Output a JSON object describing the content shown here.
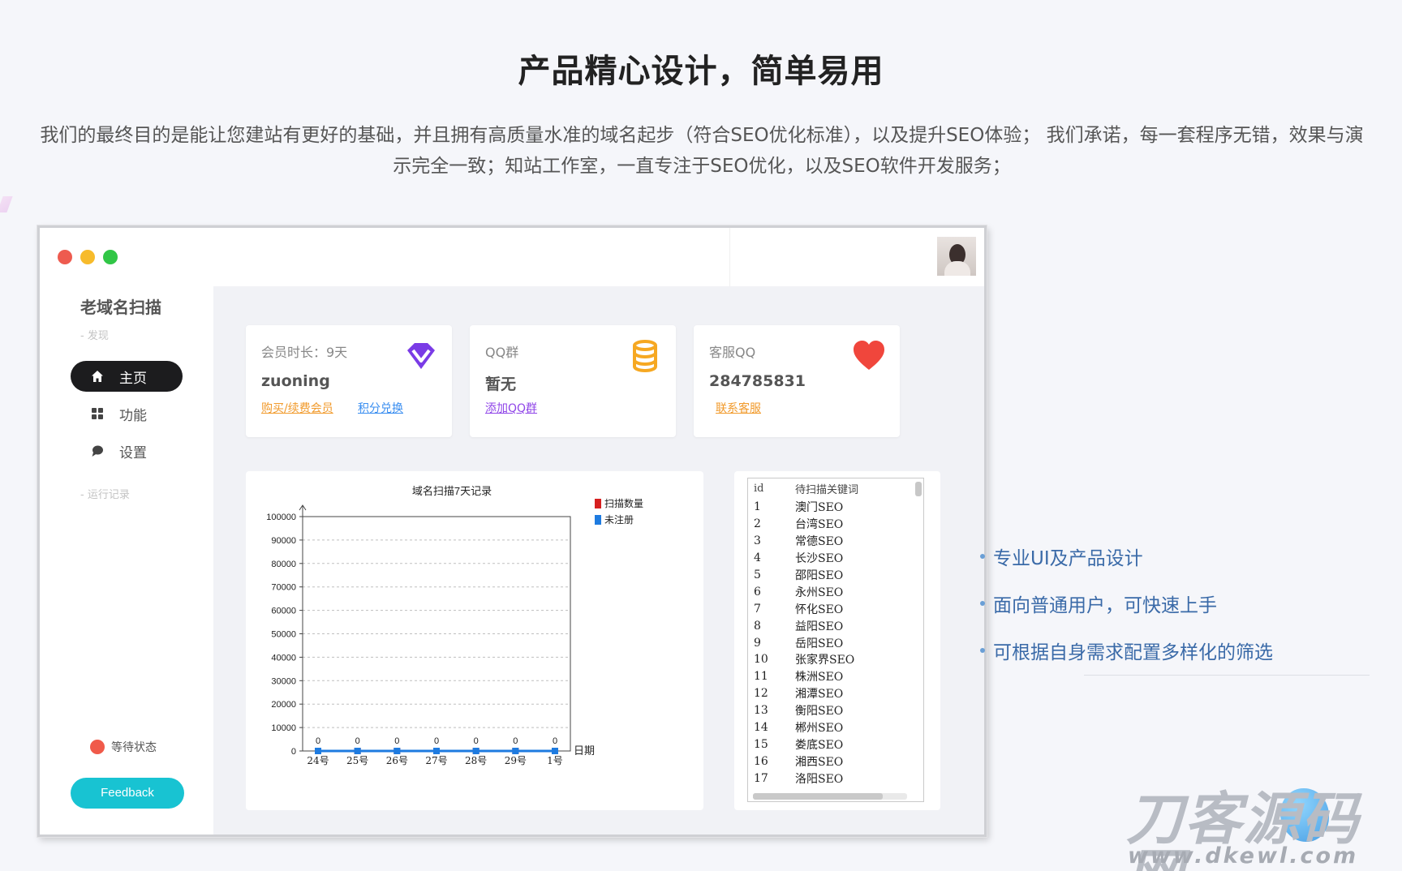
{
  "headline": "产品精心设计，简单易用",
  "intro": "我们的最终目的是能让您建站有更好的基础，并且拥有高质量水准的域名起步（符合SEO优化标准），以及提升SEO体验； 我们承诺，每一套程序无错，效果与演示完全一致；知站工作室，一直专注于SEO优化，以及SEO软件开发服务；",
  "app": {
    "name": "老域名扫描",
    "section_discover": "- 发现",
    "section_log": "- 运行记录",
    "nav": [
      {
        "label": "主页",
        "icon": "home-icon"
      },
      {
        "label": "功能",
        "icon": "grid-icon"
      },
      {
        "label": "设置",
        "icon": "chat-icon"
      }
    ],
    "status": "等待状态",
    "feedback": "Feedback",
    "cards": [
      {
        "title": "会员时长：9天",
        "value": "zuoning",
        "links": [
          "购买/续费会员",
          "积分兑换"
        ],
        "icon": "diamond-icon"
      },
      {
        "title": "QQ群",
        "value": "暂无",
        "links": [
          "添加QQ群"
        ],
        "icon": "database-icon"
      },
      {
        "title": "客服QQ",
        "value": "284785831",
        "links": [
          "联系客服"
        ],
        "icon": "heart-icon"
      }
    ],
    "keyword_list": {
      "headers": [
        "id",
        "待扫描关键词"
      ],
      "rows": [
        [
          "1",
          "澳门SEO"
        ],
        [
          "2",
          "台湾SEO"
        ],
        [
          "3",
          "常德SEO"
        ],
        [
          "4",
          "长沙SEO"
        ],
        [
          "5",
          "邵阳SEO"
        ],
        [
          "6",
          "永州SEO"
        ],
        [
          "7",
          "怀化SEO"
        ],
        [
          "8",
          "益阳SEO"
        ],
        [
          "9",
          "岳阳SEO"
        ],
        [
          "10",
          "张家界SEO"
        ],
        [
          "11",
          "株洲SEO"
        ],
        [
          "12",
          "湘潭SEO"
        ],
        [
          "13",
          "衡阳SEO"
        ],
        [
          "14",
          "郴州SEO"
        ],
        [
          "15",
          "娄底SEO"
        ],
        [
          "16",
          "湘西SEO"
        ],
        [
          "17",
          "洛阳SEO"
        ]
      ]
    }
  },
  "chart_data": {
    "type": "line",
    "title": "域名扫描7天记录",
    "xlabel": "日期",
    "ylabel": "",
    "categories": [
      "24号",
      "25号",
      "26号",
      "27号",
      "28号",
      "29号",
      "1号"
    ],
    "series": [
      {
        "name": "扫描数量",
        "values": [
          0,
          0,
          0,
          0,
          0,
          0,
          0
        ],
        "color": "#d62020"
      },
      {
        "name": "未注册",
        "values": [
          0,
          0,
          0,
          0,
          0,
          0,
          0
        ],
        "color": "#1e7be0"
      }
    ],
    "ylim": [
      0,
      100000
    ],
    "yticks": [
      0,
      10000,
      20000,
      30000,
      40000,
      50000,
      60000,
      70000,
      80000,
      90000,
      100000
    ],
    "grid": true,
    "legend": "top-right"
  },
  "features": [
    "专业UI及产品设计",
    "面向普通用户，可快速上手",
    "可根据自身需求配置多样化的筛选"
  ],
  "watermark": {
    "brand": "刀客源码网",
    "url": "www.dkewl.com"
  }
}
